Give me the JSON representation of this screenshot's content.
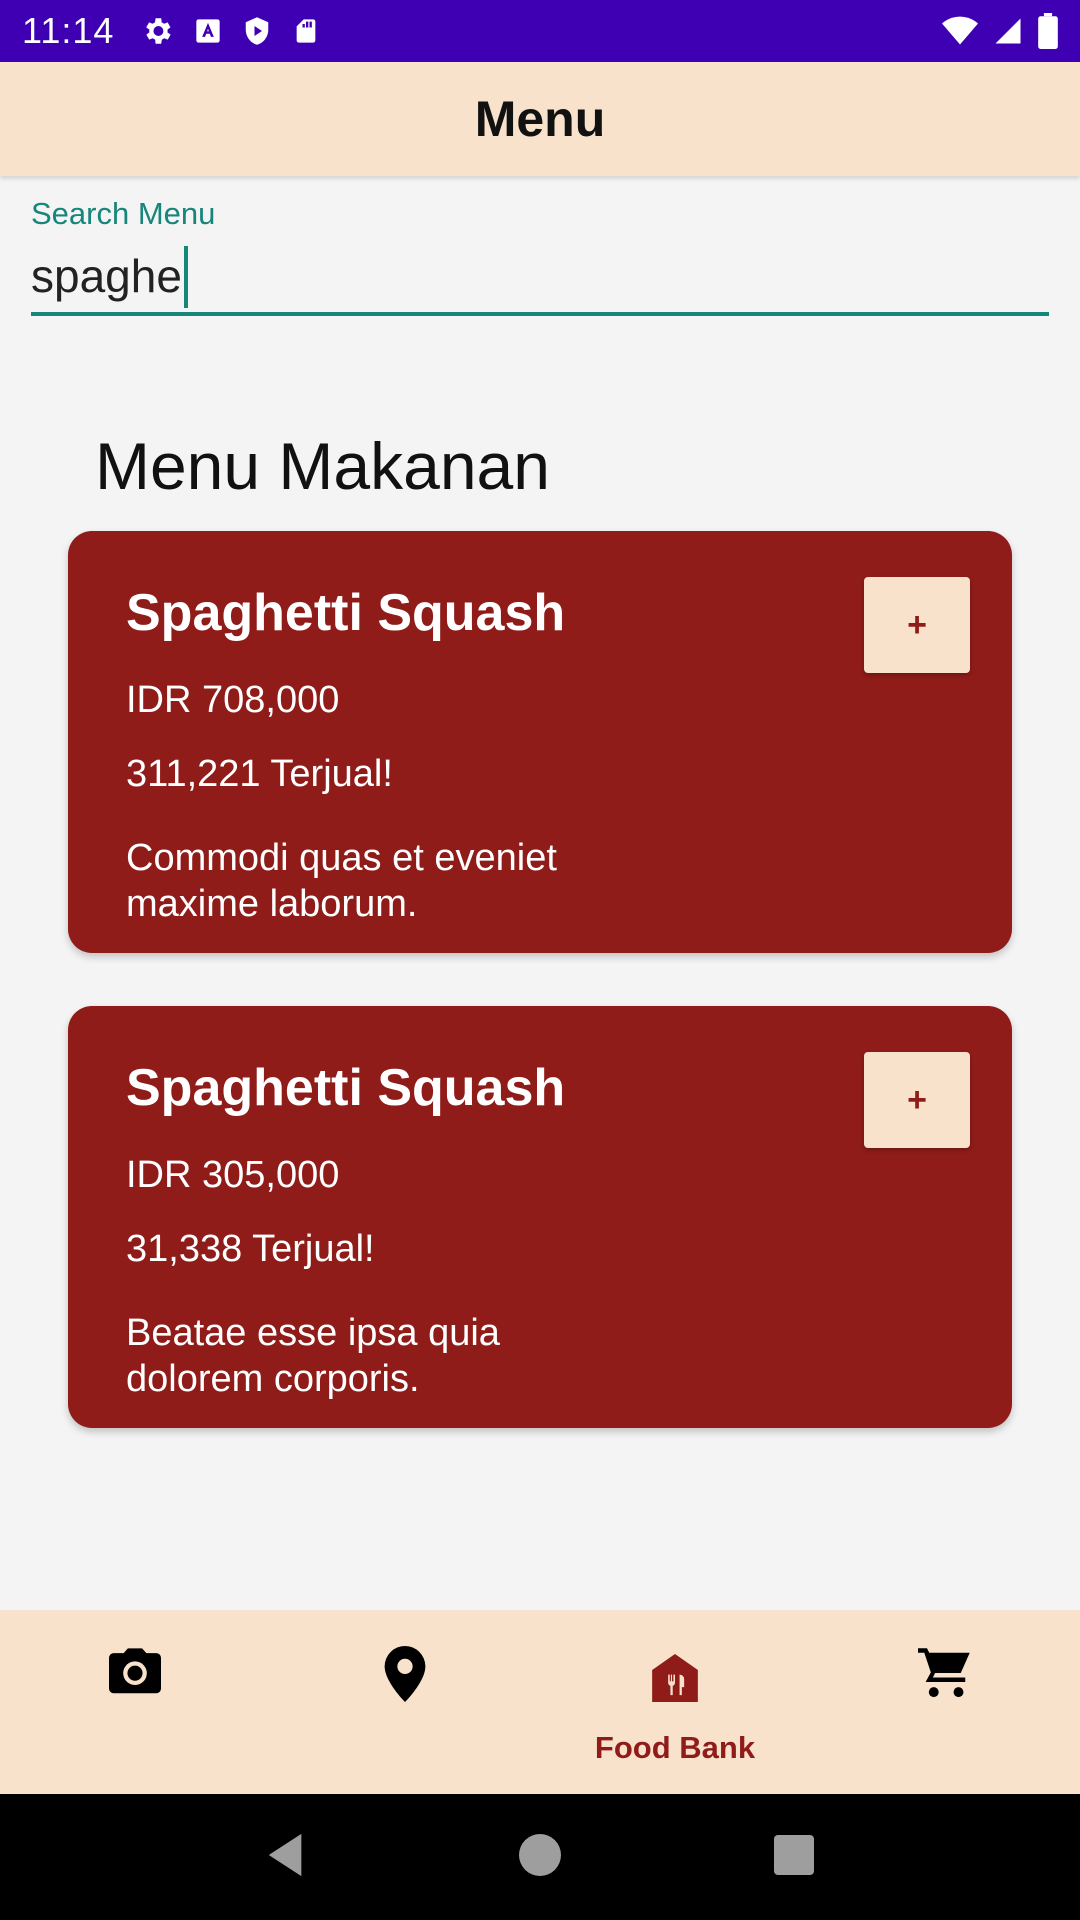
{
  "status_bar": {
    "time": "11:14",
    "left_icons": [
      "settings-icon",
      "a-square-icon",
      "play-protect-icon",
      "sd-card-icon"
    ],
    "right_icons": [
      "wifi-icon",
      "signal-icon",
      "battery-icon"
    ],
    "background": "#3f00b4"
  },
  "app_bar": {
    "title": "Menu",
    "background": "#f8e2cb"
  },
  "search": {
    "label": "Search Menu",
    "value": "spaghe",
    "accent": "#17867a"
  },
  "section": {
    "heading": "Menu Makanan"
  },
  "menu_items": [
    {
      "name": "Spaghetti Squash",
      "price": "IDR 708,000",
      "sold": "311,221 Terjual!",
      "description": "Commodi quas et eveniet maxime laborum.",
      "add_label": "+"
    },
    {
      "name": "Spaghetti Squash",
      "price": "IDR 305,000",
      "sold": "31,338 Terjual!",
      "description": "Beatae esse ipsa quia dolorem corporis.",
      "add_label": "+"
    }
  ],
  "bottom_nav": {
    "items": [
      {
        "icon": "camera-icon",
        "label": ""
      },
      {
        "icon": "location-pin-icon",
        "label": ""
      },
      {
        "icon": "food-bank-icon",
        "label": "Food Bank",
        "selected": true
      },
      {
        "icon": "cart-icon",
        "label": ""
      }
    ],
    "selected_color": "#8f1c19"
  },
  "colors": {
    "card": "#8f1c19",
    "accent": "#17867a",
    "cream": "#f8e2cb"
  }
}
